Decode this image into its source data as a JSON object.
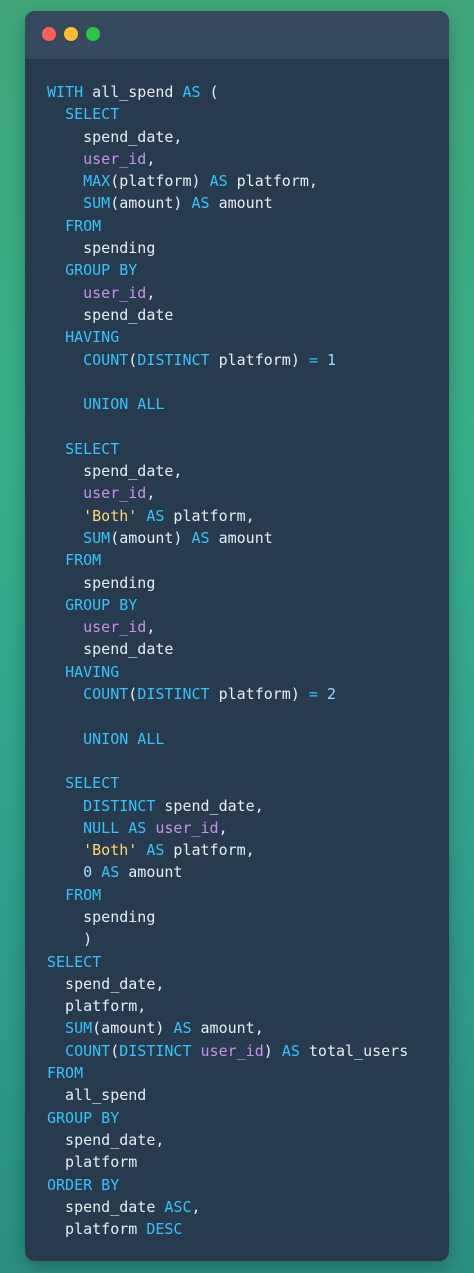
{
  "window": {
    "title_bar_dots": [
      "red",
      "yellow",
      "green"
    ],
    "dot_colors": {
      "red": "#ff5f57",
      "yellow": "#febc2e",
      "green": "#28c840"
    }
  },
  "code_lines": [
    [
      {
        "t": "kw",
        "v": "WITH "
      },
      {
        "t": "plain",
        "v": "all_spend "
      },
      {
        "t": "kw",
        "v": "AS"
      },
      {
        "t": "plain",
        "v": " ("
      }
    ],
    [
      {
        "t": "plain",
        "v": "  "
      },
      {
        "t": "kw",
        "v": "SELECT"
      }
    ],
    [
      {
        "t": "plain",
        "v": "    spend_date,"
      }
    ],
    [
      {
        "t": "plain",
        "v": "    "
      },
      {
        "t": "id",
        "v": "user_id"
      },
      {
        "t": "plain",
        "v": ","
      }
    ],
    [
      {
        "t": "plain",
        "v": "    "
      },
      {
        "t": "fn",
        "v": "MAX"
      },
      {
        "t": "plain",
        "v": "(platform) "
      },
      {
        "t": "kw",
        "v": "AS"
      },
      {
        "t": "plain",
        "v": " platform,"
      }
    ],
    [
      {
        "t": "plain",
        "v": "    "
      },
      {
        "t": "fn",
        "v": "SUM"
      },
      {
        "t": "plain",
        "v": "(amount) "
      },
      {
        "t": "kw",
        "v": "AS"
      },
      {
        "t": "plain",
        "v": " amount"
      }
    ],
    [
      {
        "t": "plain",
        "v": "  "
      },
      {
        "t": "kw",
        "v": "FROM"
      }
    ],
    [
      {
        "t": "plain",
        "v": "    spending"
      }
    ],
    [
      {
        "t": "plain",
        "v": "  "
      },
      {
        "t": "kw",
        "v": "GROUP BY"
      }
    ],
    [
      {
        "t": "plain",
        "v": "    "
      },
      {
        "t": "id",
        "v": "user_id"
      },
      {
        "t": "plain",
        "v": ","
      }
    ],
    [
      {
        "t": "plain",
        "v": "    spend_date"
      }
    ],
    [
      {
        "t": "plain",
        "v": "  "
      },
      {
        "t": "kw",
        "v": "HAVING"
      }
    ],
    [
      {
        "t": "plain",
        "v": "    "
      },
      {
        "t": "fn",
        "v": "COUNT"
      },
      {
        "t": "plain",
        "v": "("
      },
      {
        "t": "kw",
        "v": "DISTINCT"
      },
      {
        "t": "plain",
        "v": " platform) "
      },
      {
        "t": "op",
        "v": "="
      },
      {
        "t": "plain",
        "v": " "
      },
      {
        "t": "num",
        "v": "1"
      }
    ],
    [
      {
        "t": "plain",
        "v": ""
      }
    ],
    [
      {
        "t": "plain",
        "v": "    "
      },
      {
        "t": "kw",
        "v": "UNION ALL"
      }
    ],
    [
      {
        "t": "plain",
        "v": ""
      }
    ],
    [
      {
        "t": "plain",
        "v": "  "
      },
      {
        "t": "kw",
        "v": "SELECT"
      }
    ],
    [
      {
        "t": "plain",
        "v": "    spend_date,"
      }
    ],
    [
      {
        "t": "plain",
        "v": "    "
      },
      {
        "t": "id",
        "v": "user_id"
      },
      {
        "t": "plain",
        "v": ","
      }
    ],
    [
      {
        "t": "plain",
        "v": "    "
      },
      {
        "t": "str",
        "v": "'Both'"
      },
      {
        "t": "plain",
        "v": " "
      },
      {
        "t": "kw",
        "v": "AS"
      },
      {
        "t": "plain",
        "v": " platform,"
      }
    ],
    [
      {
        "t": "plain",
        "v": "    "
      },
      {
        "t": "fn",
        "v": "SUM"
      },
      {
        "t": "plain",
        "v": "(amount) "
      },
      {
        "t": "kw",
        "v": "AS"
      },
      {
        "t": "plain",
        "v": " amount"
      }
    ],
    [
      {
        "t": "plain",
        "v": "  "
      },
      {
        "t": "kw",
        "v": "FROM"
      }
    ],
    [
      {
        "t": "plain",
        "v": "    spending"
      }
    ],
    [
      {
        "t": "plain",
        "v": "  "
      },
      {
        "t": "kw",
        "v": "GROUP BY"
      }
    ],
    [
      {
        "t": "plain",
        "v": "    "
      },
      {
        "t": "id",
        "v": "user_id"
      },
      {
        "t": "plain",
        "v": ","
      }
    ],
    [
      {
        "t": "plain",
        "v": "    spend_date"
      }
    ],
    [
      {
        "t": "plain",
        "v": "  "
      },
      {
        "t": "kw",
        "v": "HAVING"
      }
    ],
    [
      {
        "t": "plain",
        "v": "    "
      },
      {
        "t": "fn",
        "v": "COUNT"
      },
      {
        "t": "plain",
        "v": "("
      },
      {
        "t": "kw",
        "v": "DISTINCT"
      },
      {
        "t": "plain",
        "v": " platform) "
      },
      {
        "t": "op",
        "v": "="
      },
      {
        "t": "plain",
        "v": " "
      },
      {
        "t": "num",
        "v": "2"
      }
    ],
    [
      {
        "t": "plain",
        "v": ""
      }
    ],
    [
      {
        "t": "plain",
        "v": "    "
      },
      {
        "t": "kw",
        "v": "UNION ALL"
      }
    ],
    [
      {
        "t": "plain",
        "v": ""
      }
    ],
    [
      {
        "t": "plain",
        "v": "  "
      },
      {
        "t": "kw",
        "v": "SELECT"
      }
    ],
    [
      {
        "t": "plain",
        "v": "    "
      },
      {
        "t": "kw",
        "v": "DISTINCT"
      },
      {
        "t": "plain",
        "v": " spend_date,"
      }
    ],
    [
      {
        "t": "plain",
        "v": "    "
      },
      {
        "t": "kw",
        "v": "NULL"
      },
      {
        "t": "plain",
        "v": " "
      },
      {
        "t": "kw",
        "v": "AS"
      },
      {
        "t": "plain",
        "v": " "
      },
      {
        "t": "id",
        "v": "user_id"
      },
      {
        "t": "plain",
        "v": ","
      }
    ],
    [
      {
        "t": "plain",
        "v": "    "
      },
      {
        "t": "str",
        "v": "'Both'"
      },
      {
        "t": "plain",
        "v": " "
      },
      {
        "t": "kw",
        "v": "AS"
      },
      {
        "t": "plain",
        "v": " platform,"
      }
    ],
    [
      {
        "t": "plain",
        "v": "    "
      },
      {
        "t": "num",
        "v": "0"
      },
      {
        "t": "plain",
        "v": " "
      },
      {
        "t": "kw",
        "v": "AS"
      },
      {
        "t": "plain",
        "v": " amount"
      }
    ],
    [
      {
        "t": "plain",
        "v": "  "
      },
      {
        "t": "kw",
        "v": "FROM"
      }
    ],
    [
      {
        "t": "plain",
        "v": "    spending"
      }
    ],
    [
      {
        "t": "plain",
        "v": "    )"
      }
    ],
    [
      {
        "t": "kw",
        "v": "SELECT"
      }
    ],
    [
      {
        "t": "plain",
        "v": "  spend_date,"
      }
    ],
    [
      {
        "t": "plain",
        "v": "  platform,"
      }
    ],
    [
      {
        "t": "plain",
        "v": "  "
      },
      {
        "t": "fn",
        "v": "SUM"
      },
      {
        "t": "plain",
        "v": "(amount) "
      },
      {
        "t": "kw",
        "v": "AS"
      },
      {
        "t": "plain",
        "v": " amount,"
      }
    ],
    [
      {
        "t": "plain",
        "v": "  "
      },
      {
        "t": "fn",
        "v": "COUNT"
      },
      {
        "t": "plain",
        "v": "("
      },
      {
        "t": "kw",
        "v": "DISTINCT"
      },
      {
        "t": "plain",
        "v": " "
      },
      {
        "t": "id",
        "v": "user_id"
      },
      {
        "t": "plain",
        "v": ") "
      },
      {
        "t": "kw",
        "v": "AS"
      },
      {
        "t": "plain",
        "v": " total_users"
      }
    ],
    [
      {
        "t": "kw",
        "v": "FROM"
      }
    ],
    [
      {
        "t": "plain",
        "v": "  all_spend"
      }
    ],
    [
      {
        "t": "kw",
        "v": "GROUP BY"
      }
    ],
    [
      {
        "t": "plain",
        "v": "  spend_date,"
      }
    ],
    [
      {
        "t": "plain",
        "v": "  platform"
      }
    ],
    [
      {
        "t": "kw",
        "v": "ORDER BY"
      }
    ],
    [
      {
        "t": "plain",
        "v": "  spend_date "
      },
      {
        "t": "kw",
        "v": "ASC"
      },
      {
        "t": "plain",
        "v": ","
      }
    ],
    [
      {
        "t": "plain",
        "v": "  platform "
      },
      {
        "t": "kw",
        "v": "DESC"
      }
    ]
  ]
}
